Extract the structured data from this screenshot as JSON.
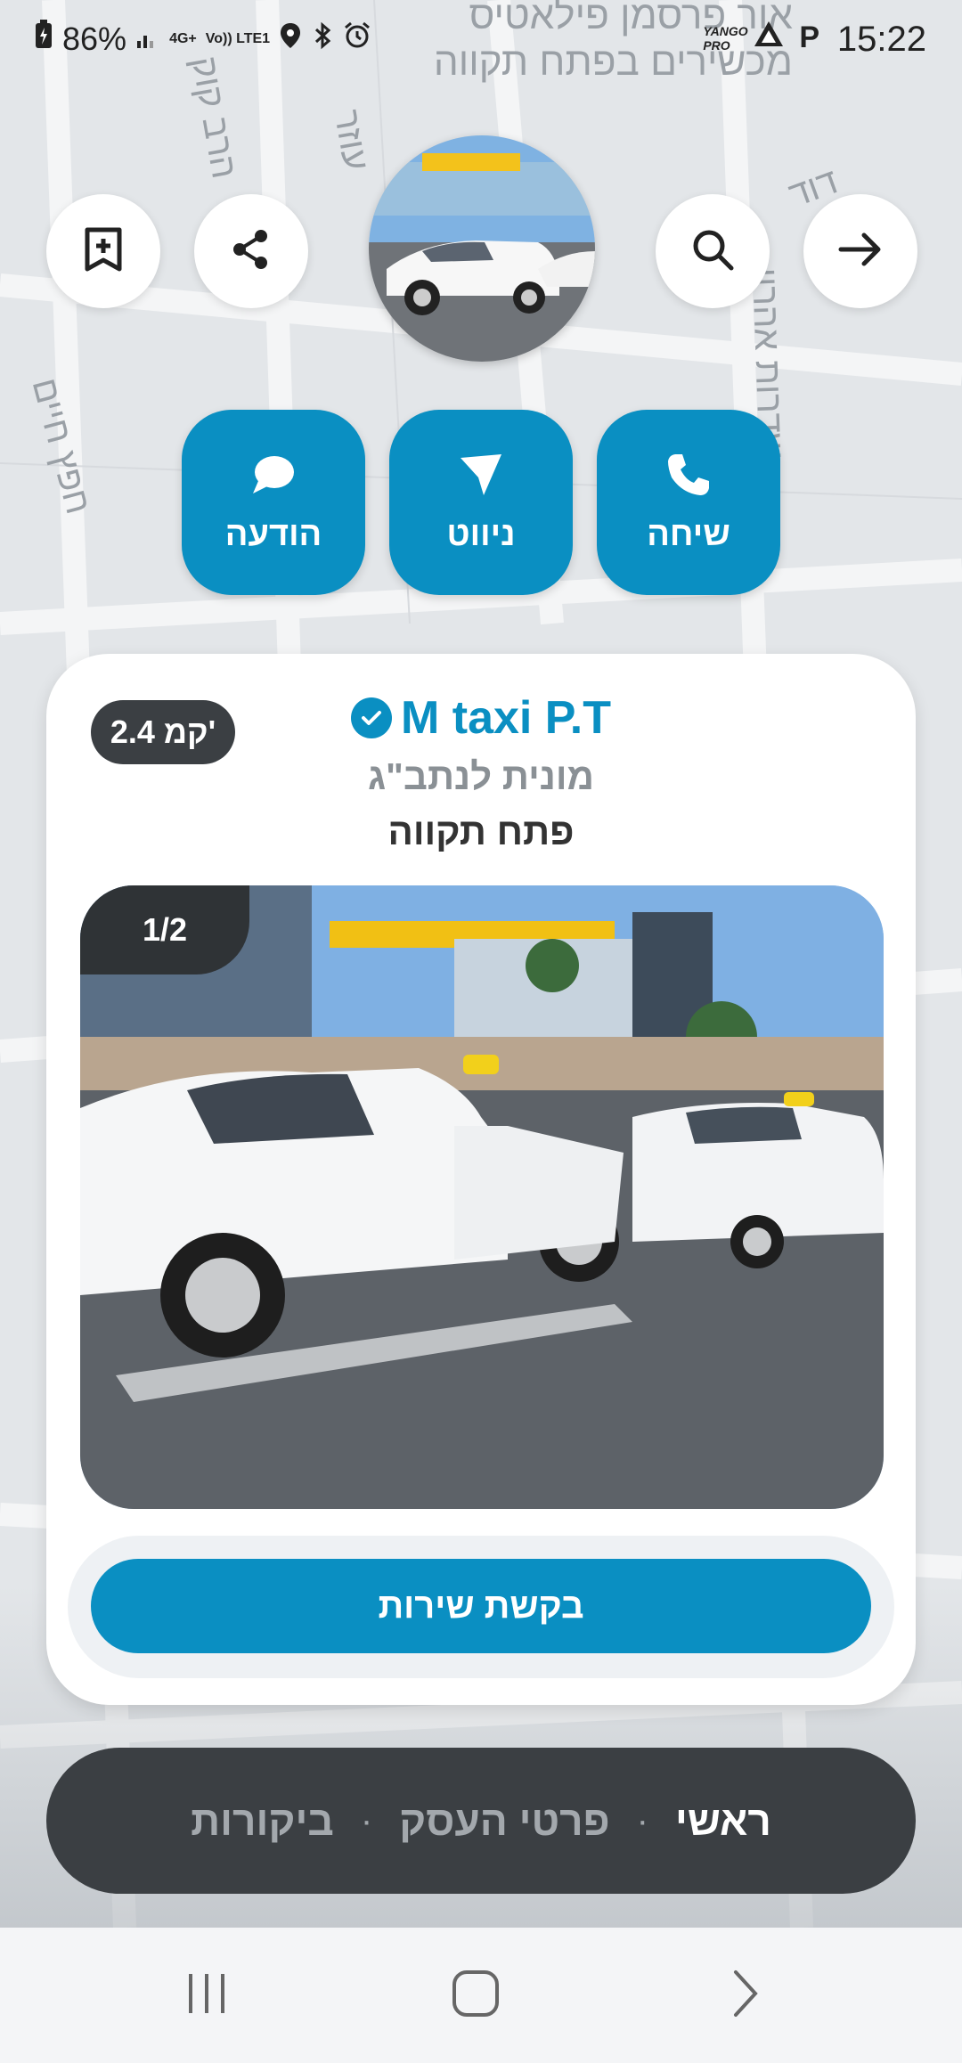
{
  "status_bar": {
    "time": "15:22",
    "battery": "86%",
    "network": "4G+",
    "volte": "Vo)) LTE1",
    "yango_label": "YANGO PRO",
    "parking_letter": "P"
  },
  "map": {
    "title_line1": "אור פרסמן פילאטיס",
    "title_line2": "מכשירים בפתח תקווה",
    "street_labels": [
      "הרב קוק",
      "חפץ חיים",
      "עוזר",
      "שדרות אהרון",
      "דוד"
    ]
  },
  "header": {
    "back_icon": "arrow-right-icon",
    "search_icon": "search-icon",
    "share_icon": "share-icon",
    "save_icon": "bookmark-add-icon"
  },
  "actions": [
    {
      "label": "שיחה",
      "icon": "phone-icon"
    },
    {
      "label": "ניווט",
      "icon": "navigation-icon"
    },
    {
      "label": "הודעה",
      "icon": "chat-icon"
    }
  ],
  "business": {
    "name": "M taxi P.T",
    "category": "מונית לנתב\"ג",
    "city": "פתח תקווה",
    "distance": "2.4 קמ'",
    "photo_counter": "1/2",
    "request_button": "בקשת שירות"
  },
  "tabs": [
    {
      "label": "ראשי",
      "active": true
    },
    {
      "label": "פרטי העסק",
      "active": false
    },
    {
      "label": "ביקורות",
      "active": false
    }
  ],
  "nav": {
    "recents": "recents-icon",
    "home": "home-icon",
    "back": "back-icon"
  },
  "colors": {
    "accent": "#0a8fc2",
    "dark_pill": "#3b3f43",
    "map_bg": "#e3e6e9"
  }
}
